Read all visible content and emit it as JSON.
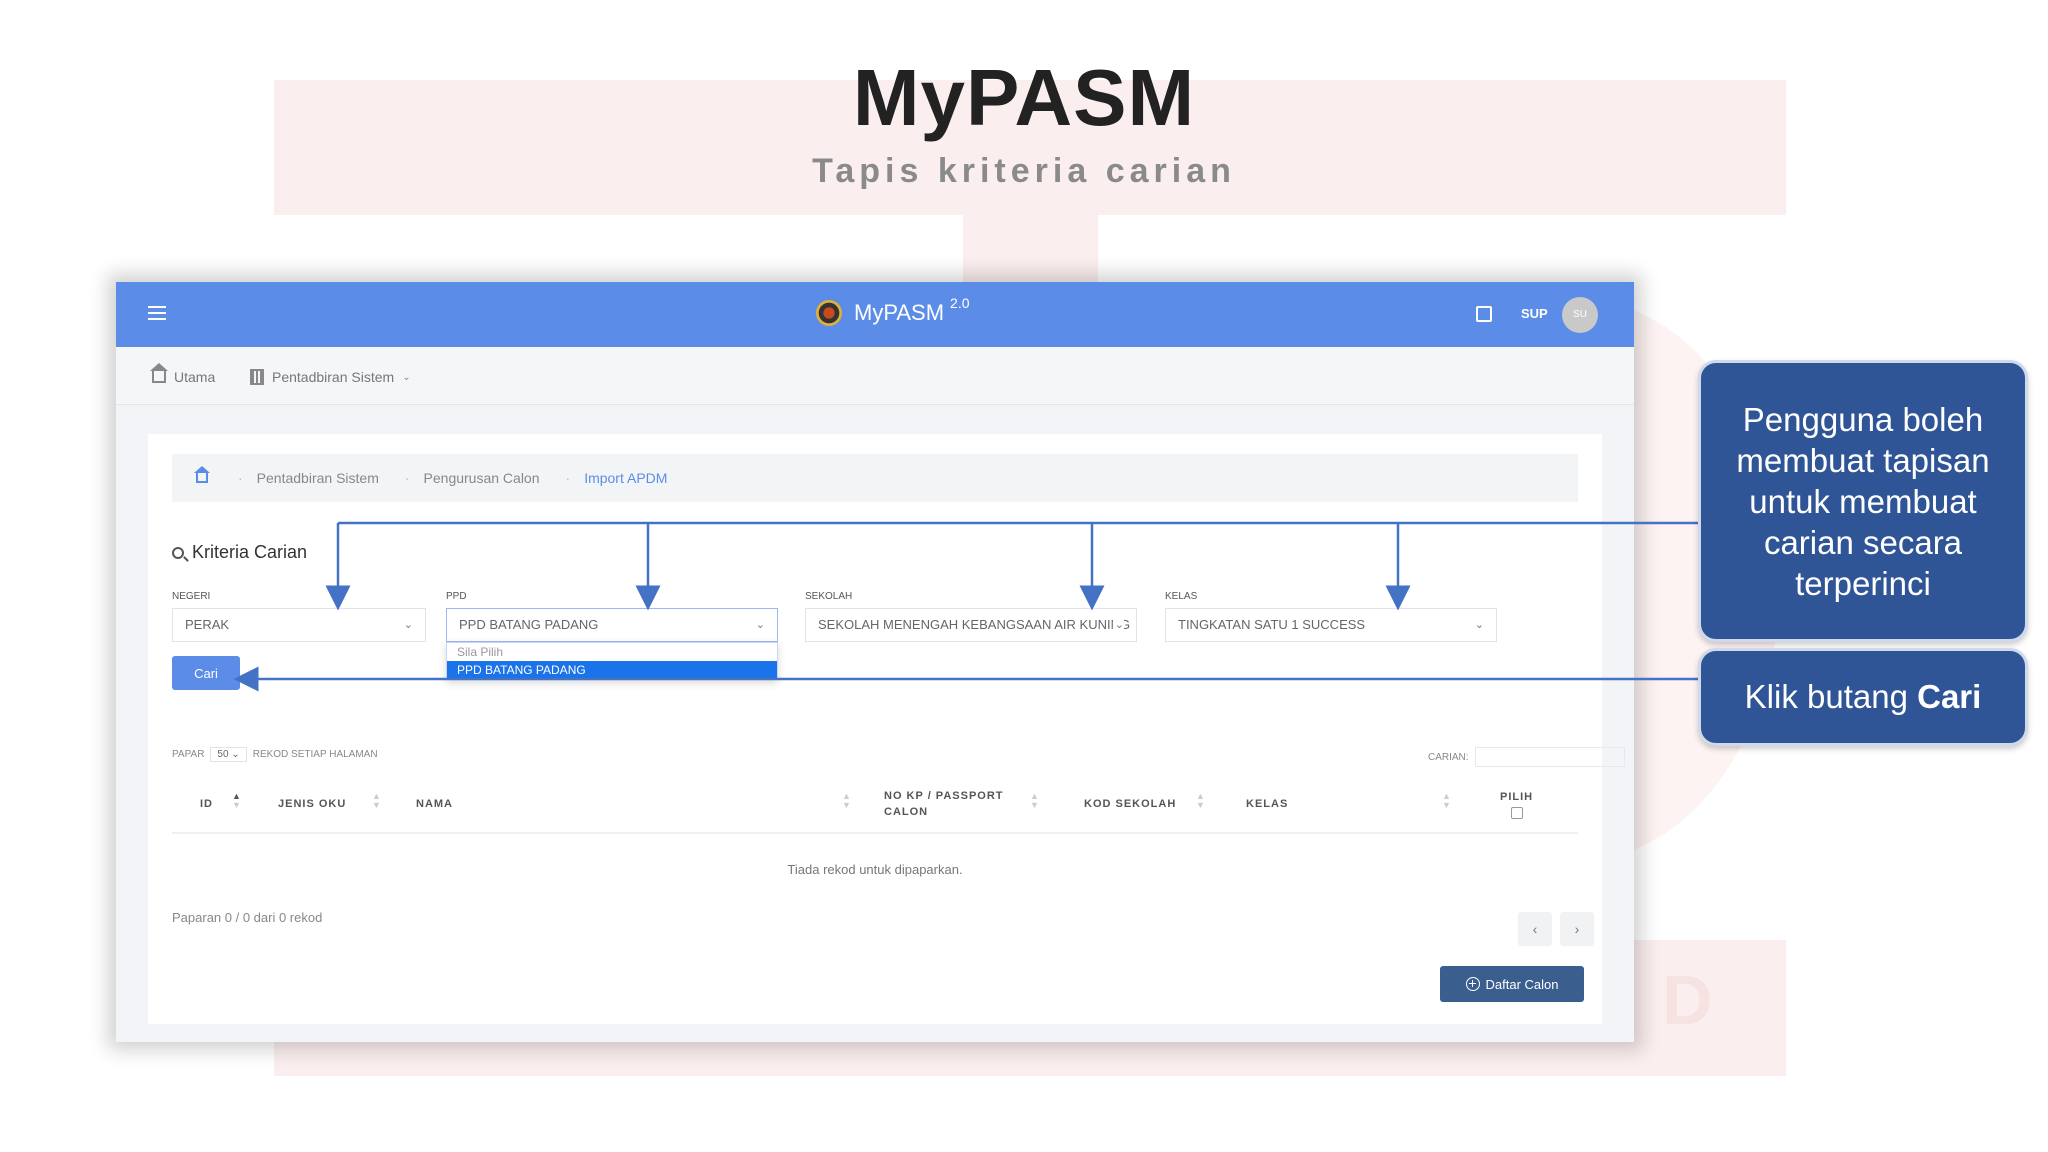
{
  "slide": {
    "title": "MyPASM",
    "subtitle": "Tapis kriteria carian"
  },
  "app": {
    "brand": "MyPASM",
    "version": "2.0",
    "user_code": "SUP",
    "avatar_initials": "SU",
    "nav": {
      "home": "Utama",
      "admin": "Pentadbiran Sistem"
    },
    "breadcrumb": [
      "Pentadbiran Sistem",
      "Pengurusan Calon",
      "Import APDM"
    ],
    "section_title": "Kriteria Carian",
    "filters": {
      "negeri": {
        "label": "NEGERI",
        "value": "PERAK"
      },
      "ppd": {
        "label": "PPD",
        "value": "PPD BATANG PADANG",
        "options": [
          "Sila Pilih",
          "PPD BATANG PADANG"
        ]
      },
      "sekolah": {
        "label": "SEKOLAH",
        "value": "SEKOLAH MENENGAH KEBANGSAAN AIR KUNING"
      },
      "kelas": {
        "label": "KELAS",
        "value": "TINGKATAN SATU 1 SUCCESS"
      }
    },
    "search_button": "Cari",
    "table": {
      "show_label": "PAPAR",
      "page_size": "50",
      "per_page_label": "REKOD SETIAP HALAMAN",
      "search_label": "CARIAN:",
      "columns": [
        "ID",
        "JENIS OKU",
        "NAMA",
        "NO KP / PASSPORT CALON",
        "KOD SEKOLAH",
        "KELAS",
        "PILIH"
      ],
      "empty_message": "Tiada rekod untuk dipaparkan.",
      "info": "Paparan 0 / 0 dari 0 rekod",
      "prev": "‹",
      "next": "›"
    },
    "list_button": "Daftar Calon"
  },
  "callouts": {
    "filter_text": "Pengguna boleh membuat tapisan untuk membuat carian secara terperinci",
    "click_prefix": "Klik butang ",
    "click_bold": "Cari"
  },
  "colors": {
    "header": "#5b8de8",
    "callout": "#2f5597",
    "arrow": "#4472c4",
    "dropdown_selected": "#1a73e8"
  }
}
